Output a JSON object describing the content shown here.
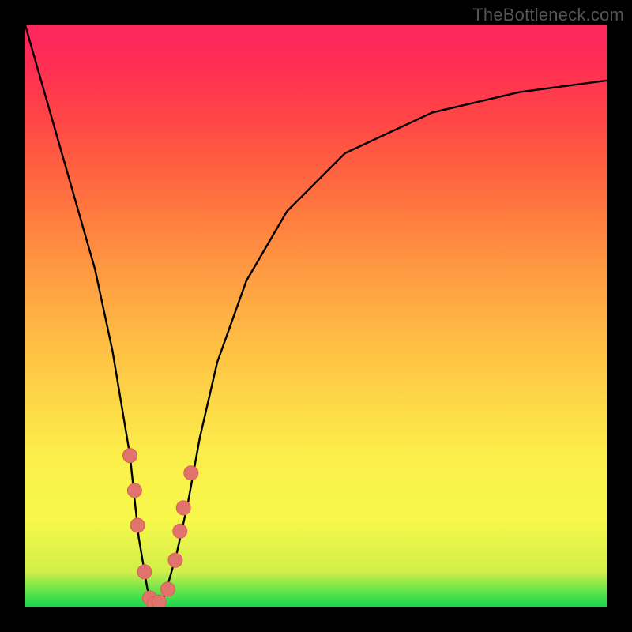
{
  "watermark": "TheBottleneck.com",
  "colors": {
    "background": "#000000",
    "curve_stroke": "#000000",
    "marker_fill": "#e0746d",
    "marker_stroke": "#d85f58"
  },
  "chart_data": {
    "type": "line",
    "title": "",
    "xlabel": "",
    "ylabel": "",
    "xlim": [
      0,
      100
    ],
    "ylim": [
      0,
      100
    ],
    "series": [
      {
        "name": "bottleneck-curve",
        "x": [
          0,
          4,
          8,
          12,
          15,
          18,
          19.5,
          21,
          22.5,
          24,
          26,
          28,
          30,
          33,
          38,
          45,
          55,
          70,
          85,
          100
        ],
        "values": [
          100,
          86,
          72,
          58,
          44,
          26,
          12,
          3,
          0,
          2,
          9,
          18,
          29,
          42,
          56,
          68,
          78,
          85,
          88.5,
          90.5
        ]
      }
    ],
    "markers": [
      {
        "x": 18.0,
        "y": 26
      },
      {
        "x": 18.8,
        "y": 20
      },
      {
        "x": 19.3,
        "y": 14
      },
      {
        "x": 20.5,
        "y": 6
      },
      {
        "x": 21.4,
        "y": 1.5
      },
      {
        "x": 22.2,
        "y": 0.5
      },
      {
        "x": 23.0,
        "y": 0.8
      },
      {
        "x": 24.5,
        "y": 3
      },
      {
        "x": 25.8,
        "y": 8
      },
      {
        "x": 26.6,
        "y": 13
      },
      {
        "x": 27.2,
        "y": 17
      },
      {
        "x": 28.5,
        "y": 23
      }
    ]
  }
}
